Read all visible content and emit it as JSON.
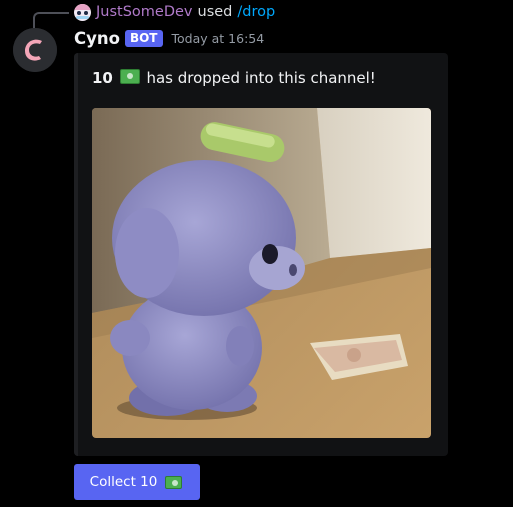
{
  "reply": {
    "username": "JustSomeDev",
    "used_text": "used",
    "command": "/drop"
  },
  "message": {
    "author": "Cyno",
    "bot_tag": "BOT",
    "timestamp": "Today at 16:54"
  },
  "embed": {
    "amount": "10",
    "description": "has dropped into this channel!",
    "currency_icon": "money-with-wings-icon"
  },
  "button": {
    "label": "Collect 10",
    "icon": "money-with-wings-icon"
  },
  "colors": {
    "blurple": "#5865f2",
    "reply_username": "#b07ac9",
    "command_link": "#00a8fc",
    "background": "#000000"
  }
}
